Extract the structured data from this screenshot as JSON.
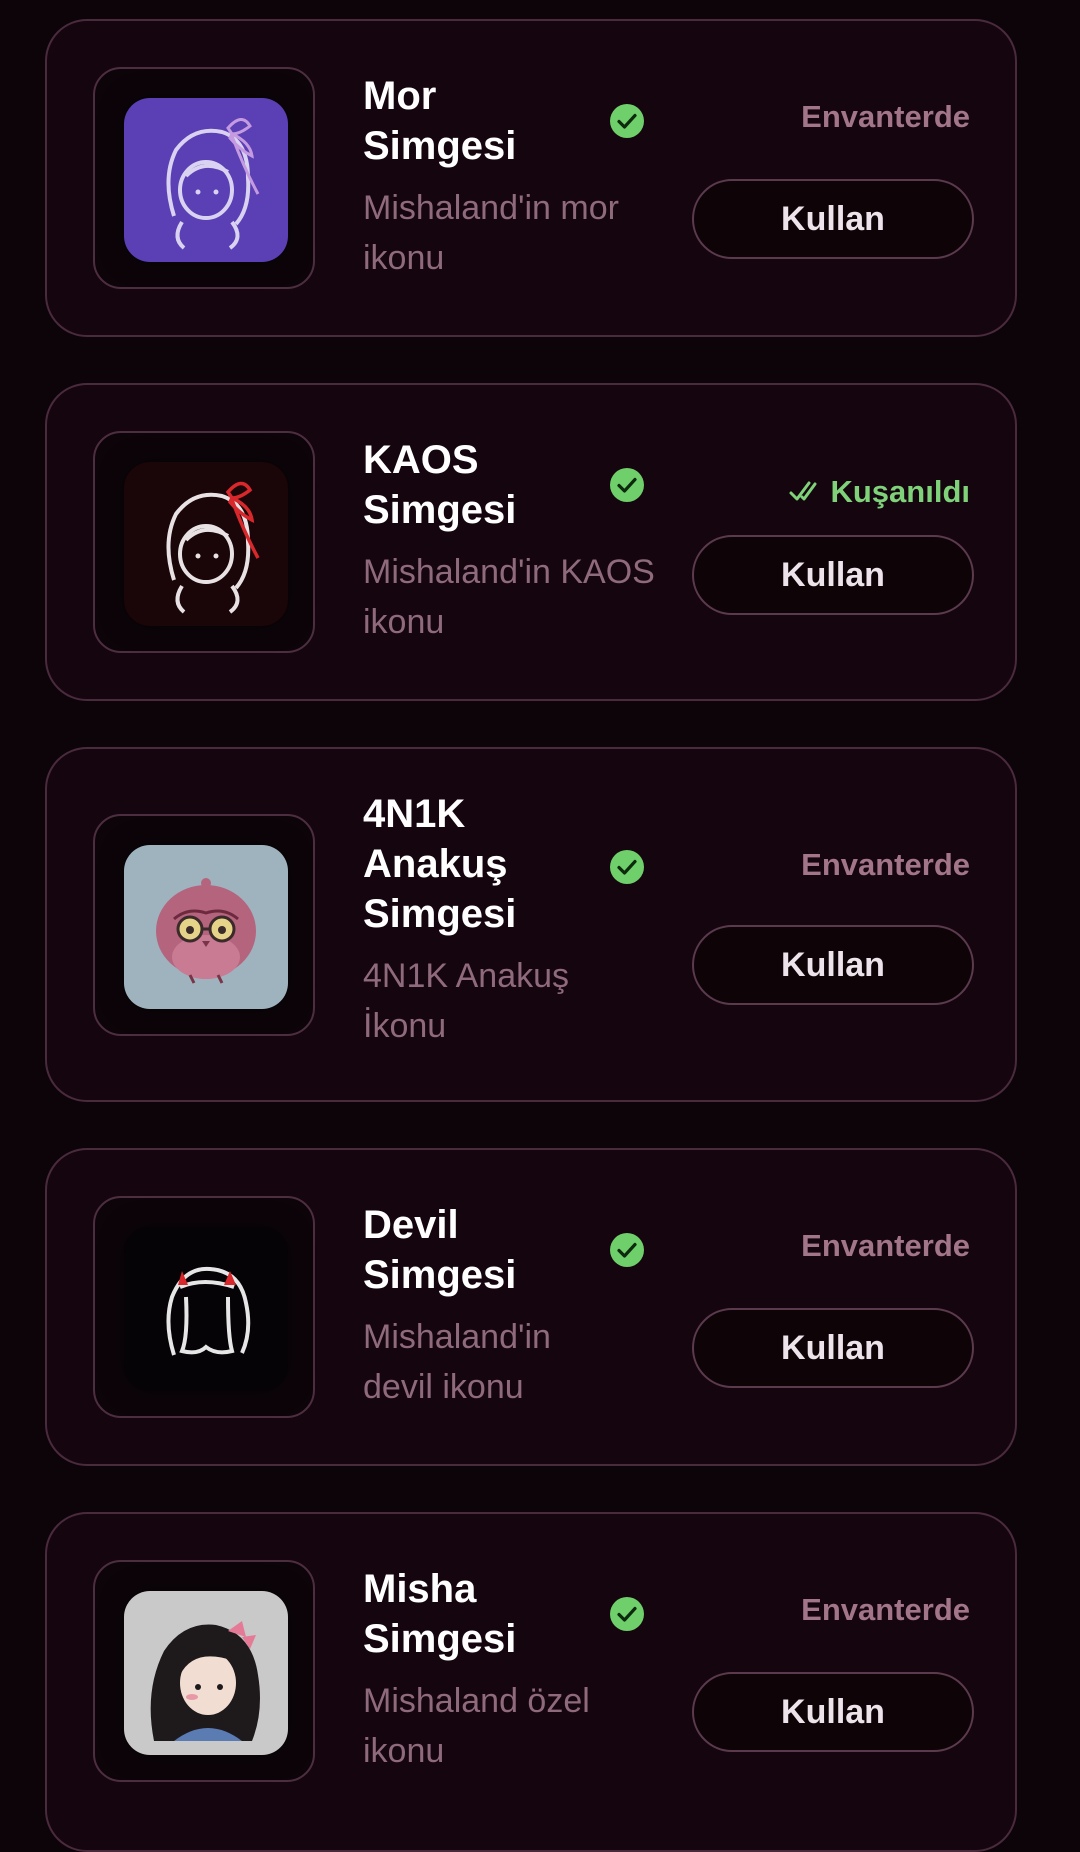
{
  "items": [
    {
      "title": "Mor Simgesi",
      "description": "Mishaland'in mor ikonu",
      "status": "Envanterde",
      "button": "Kullan",
      "icon": "mor-girl-icon",
      "tile_color": "#5a3fb5"
    },
    {
      "title": "KAOS Simgesi",
      "description": "Mishaland'in KAOS ikonu",
      "status": "Kuşanıldı",
      "button": "Kullan",
      "icon": "kaos-girl-icon",
      "tile_color": "#1a0508"
    },
    {
      "title": "4N1K Anakuş Simgesi",
      "description": "4N1K Anakuş İkonu",
      "status": "Envanterde",
      "button": "Kullan",
      "icon": "owl-icon",
      "tile_color": "#9fb3bf"
    },
    {
      "title": "Devil Simgesi",
      "description": "Mishaland'in devil ikonu",
      "status": "Envanterde",
      "button": "Kullan",
      "icon": "devil-girl-icon",
      "tile_color": "#050305"
    },
    {
      "title": "Misha Simgesi",
      "description": "Mishaland özel ikonu",
      "status": "Envanterde",
      "button": "Kullan",
      "icon": "misha-girl-icon",
      "tile_color": "#c9c9c9"
    }
  ],
  "colors": {
    "background": "#0c0409",
    "card": "#15050f",
    "border": "#4a2a3d",
    "owned_check": "#6fcf6a",
    "equipped": "#7fd17a",
    "status": "#a27588",
    "description": "#8e6a7c"
  }
}
